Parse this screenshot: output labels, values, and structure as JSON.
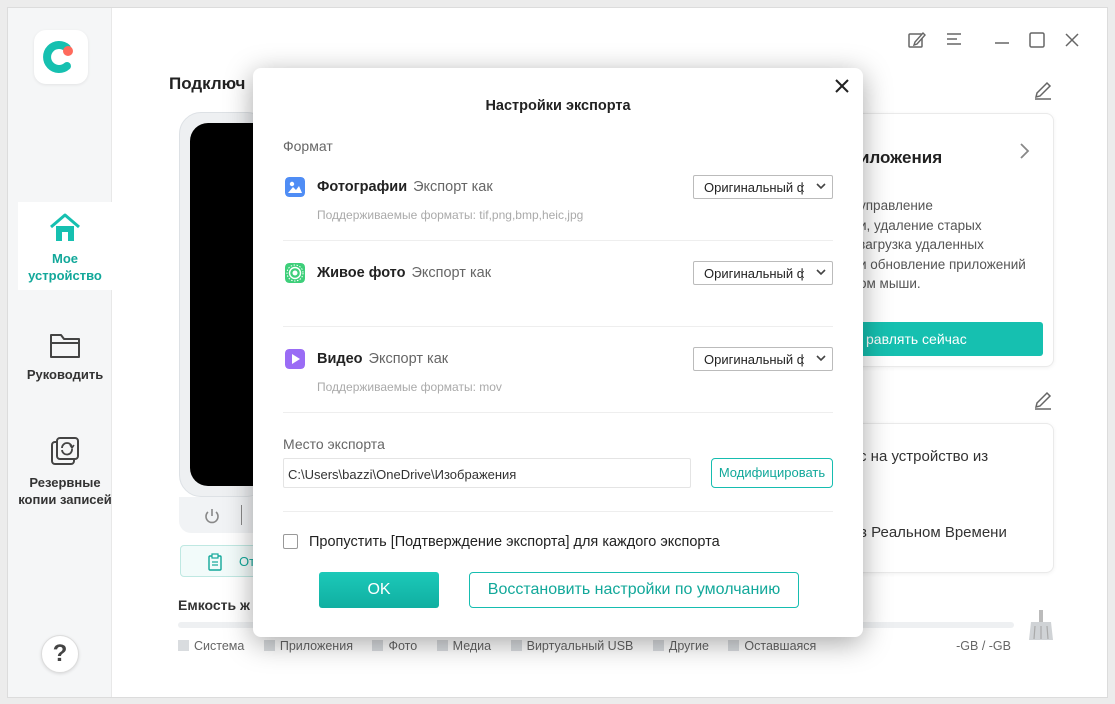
{
  "colors": {
    "accent": "#16c0b0",
    "accent_dark": "#12a89a",
    "sidebar_bg": "#f5f6f7"
  },
  "sidebar": {
    "items": [
      {
        "label_line1": "Мое",
        "label_line2": "устройство",
        "icon": "home-icon",
        "active": true
      },
      {
        "label_line1": "Руководить",
        "label_line2": "",
        "icon": "folder-icon",
        "active": false
      },
      {
        "label_line1": "Резервные",
        "label_line2": "копии записей",
        "icon": "backup-icon",
        "active": false
      }
    ],
    "help": "?"
  },
  "main": {
    "title": "Подключ",
    "side_button": "От",
    "capacity": {
      "title": "Емкость ж",
      "legend": [
        "Система",
        "Приложения",
        "Фото",
        "Медиа",
        "Виртуальный USB",
        "Другие",
        "Оставшаяся"
      ],
      "value": "-GB / -GB"
    },
    "card_apps": {
      "title": "иложения",
      "body": "управление\nи, удаление старых\nзагрузка удаленных\nи обновление приложений\nом мыши.",
      "cta": "равлять сейчас"
    },
    "card_transfer": {
      "line1": "с на устройство из",
      "line2": "в Реальном Времени"
    }
  },
  "modal": {
    "title": "Настройки экспорта",
    "format_label": "Формат",
    "rows": [
      {
        "name": "Фотографии",
        "sub": "Экспорт как",
        "hint": "Поддерживаемые форматы: tif,png,bmp,heic,jpg",
        "selected": "Оригинальный ф"
      },
      {
        "name": "Живое фото",
        "sub": "Экспорт как",
        "hint": "",
        "selected": "Оригинальный ф"
      },
      {
        "name": "Видео",
        "sub": "Экспорт как",
        "hint": "Поддерживаемые форматы: mov",
        "selected": "Оригинальный ф"
      }
    ],
    "location_label": "Место экспорта",
    "location_path": "C:\\Users\\bazzi\\OneDrive\\Изображения",
    "modify_button": "Модифицировать",
    "skip_label": "Пропустить [Подтверждение экспорта] для каждого экспорта",
    "ok_button": "OK",
    "reset_button": "Восстановить настройки по умолчанию"
  }
}
